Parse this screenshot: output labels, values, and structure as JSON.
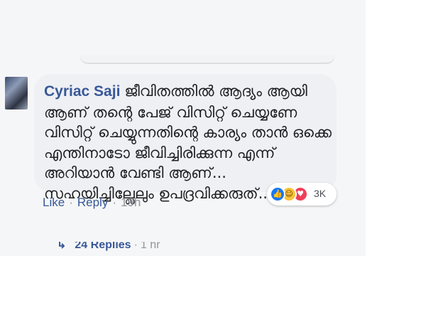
{
  "comment": {
    "author": "Cyriac Saji",
    "text": "ജീവിതത്തിൽ ആദ്യം ആയി ആണ് തന്റെ പേജ് വിസിറ്റ് ചെയ്യണേ വിസിറ്റ് ചെയ്യുന്നതിന്റെ കാര്യം താൻ ഒക്കെ എന്തിനാടോ ജീവിച്ചിരിക്കുന്ന എന്ന് അറിയാൻ വേണ്ടി ആണ്... സഹയിച്ചില്ലേലും ഉപദ്രവിക്കരുത്...."
  },
  "reactions": {
    "icons": [
      "like-icon",
      "haha-icon",
      "love-icon"
    ],
    "count": "3K",
    "colors": {
      "like": "#1877f2",
      "haha": "#f7c33b",
      "love": "#f33e58"
    }
  },
  "actions": {
    "like": "Like",
    "separator": "·",
    "reply": "Reply",
    "time": "19h"
  },
  "replies": {
    "label": "24 Replies",
    "separator": "·",
    "time": "1 hr"
  }
}
